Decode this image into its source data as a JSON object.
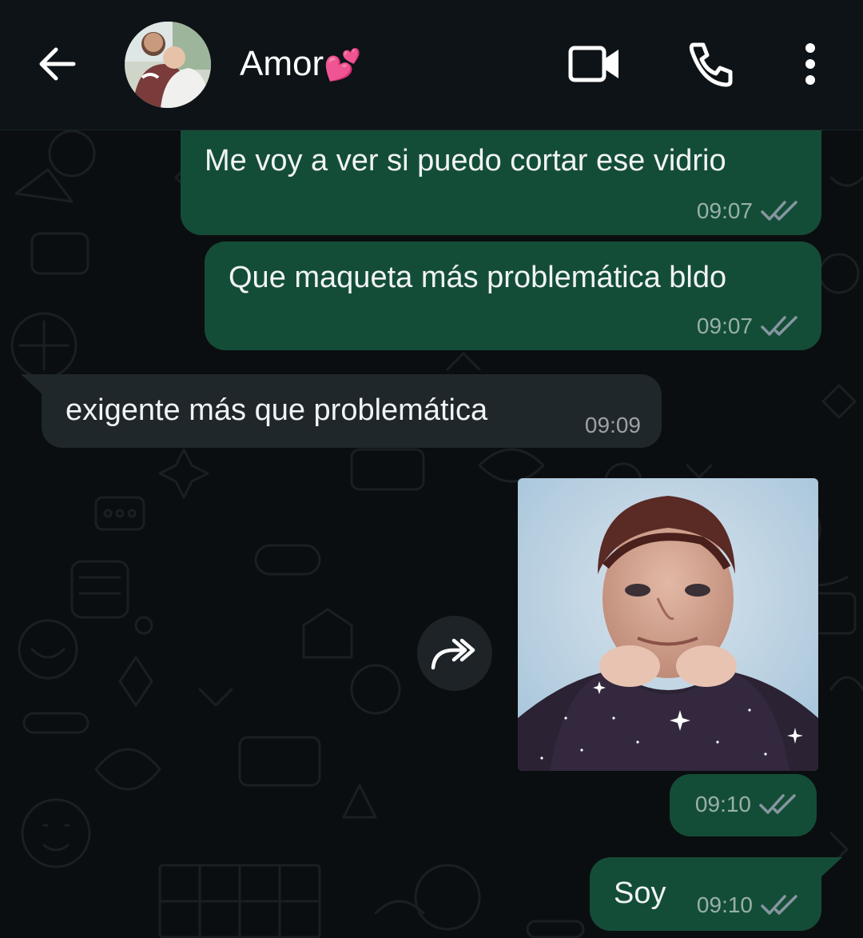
{
  "header": {
    "contact_name": "Amor",
    "contact_emoji": "💕"
  },
  "messages": [
    {
      "direction": "out",
      "text": "Me voy a ver si puedo cortar ese vidrio",
      "time": "09:07",
      "status": "read"
    },
    {
      "direction": "out",
      "text": "Que maqueta más problemática bldo",
      "time": "09:07",
      "status": "read"
    },
    {
      "direction": "in",
      "text": "exigente más que problemática",
      "time": "09:09"
    },
    {
      "direction": "out",
      "type": "image",
      "time": "09:10",
      "status": "read"
    },
    {
      "direction": "out",
      "text": "Soy",
      "time": "09:10",
      "status": "read"
    }
  ],
  "colors": {
    "header_bg": "#0d1317",
    "chat_bg": "#0b0e10",
    "outgoing_bubble": "#144d37",
    "incoming_bubble": "#1f272a",
    "read_ticks": "#8696a0"
  },
  "icons": {
    "back": "arrow-left-icon",
    "video": "video-camera-icon",
    "call": "phone-icon",
    "menu": "more-vertical-icon",
    "forward": "forward-share-icon",
    "ticks": "double-check-icon"
  }
}
